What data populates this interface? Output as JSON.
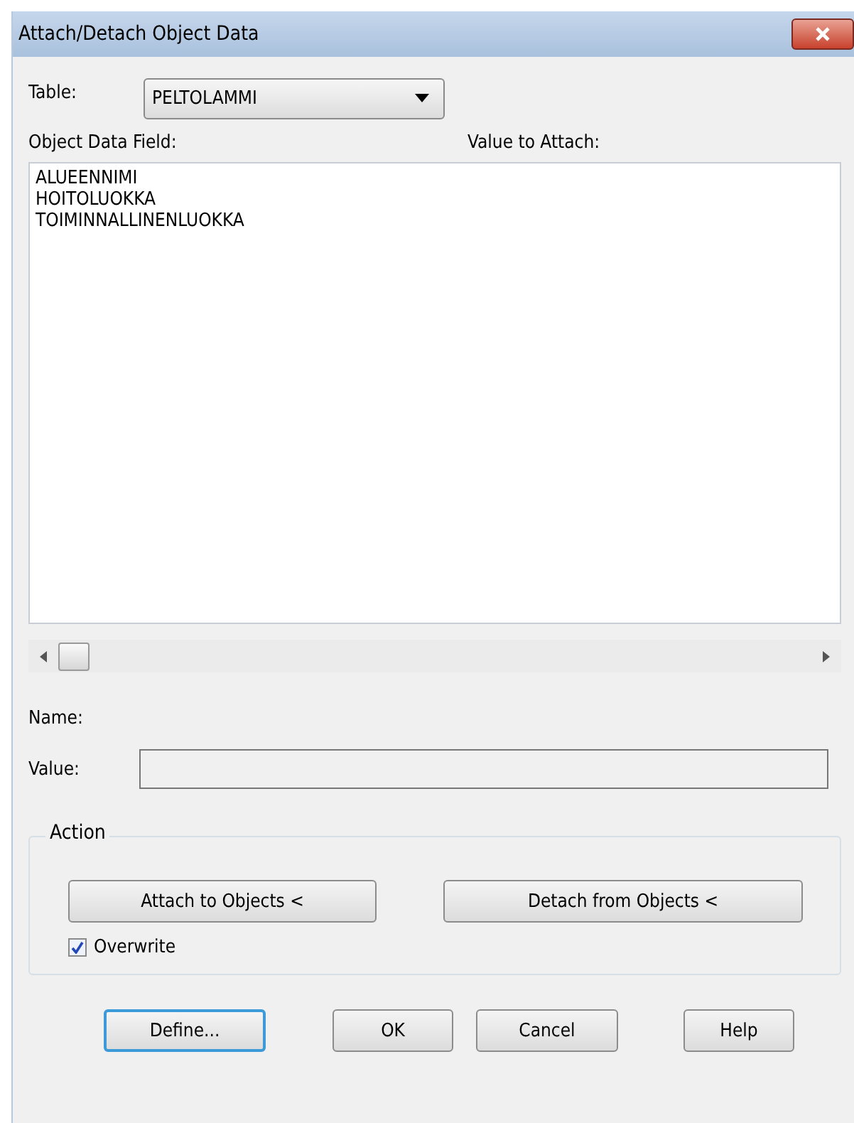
{
  "window": {
    "title": "Attach/Detach Object Data"
  },
  "table": {
    "label": "Table:",
    "value": "PELTOLAMMI"
  },
  "columns": [
    "Object Data Field:",
    "Value to Attach:"
  ],
  "fields": [
    {
      "name": "ALUEENNIMI"
    },
    {
      "name": "HOITOLUOKKA"
    },
    {
      "name": "TOIMINNALLINENLUOKKA"
    }
  ],
  "name_label": "Name:",
  "value_field": {
    "label": "Value:"
  },
  "action": {
    "title": "Action",
    "buttons": [
      "Attach to Objects <",
      "Detach from Objects <"
    ],
    "overwrite": {
      "label": "Overwrite",
      "checked": true
    }
  },
  "buttons": [
    {
      "label": "Define...",
      "default": true
    },
    {
      "label": "OK",
      "default": false
    },
    {
      "label": "Cancel",
      "default": false
    },
    {
      "label": "Help",
      "default": false
    }
  ]
}
